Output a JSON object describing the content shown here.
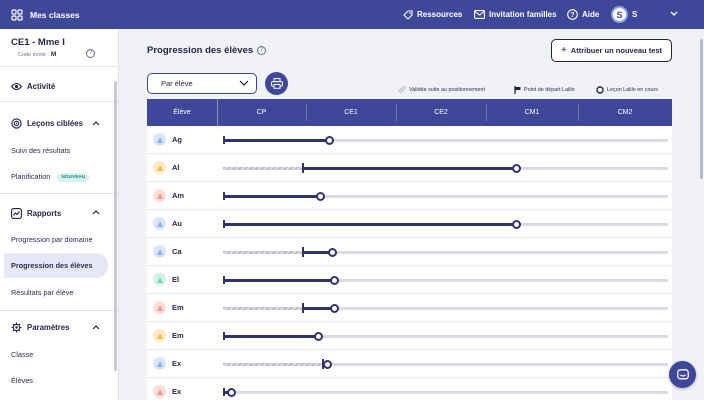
{
  "topbar": {
    "brand": "Mes classes",
    "nav": [
      {
        "label": "Ressources",
        "icon": "tag-icon"
      },
      {
        "label": "Invitation familles",
        "icon": "mail-icon"
      },
      {
        "label": "Aide",
        "icon": "help-circle-icon"
      }
    ],
    "user_initial": "S",
    "user_name": "S"
  },
  "sidebar": {
    "class_name": "CE1 - Mme I",
    "code_label": "Code école :",
    "code_value": "M",
    "sections": [
      {
        "label": "Activité",
        "icon": "eye-icon"
      },
      {
        "label": "Leçons ciblées",
        "icon": "target-icon",
        "items": [
          "Suivi des résultats",
          "Planification"
        ],
        "badge": "NOUVEAU"
      },
      {
        "label": "Rapports",
        "icon": "chart-icon",
        "items": [
          "Progression par domaine",
          "Progression des élèves",
          "Résultats par élève"
        ]
      },
      {
        "label": "Paramètres",
        "icon": "gear-icon",
        "items": [
          "Classe",
          "Élèves"
        ]
      }
    ],
    "active_item": "Progression des élèves"
  },
  "main": {
    "title": "Progression des élèves",
    "add_test_button": "Attribuer un nouveau test",
    "add_test_prefix": "+",
    "select_value": "Par élève",
    "legend": [
      "Validée suite au positionnement",
      "Point de départ Lalilo",
      "Leçon Lalilo en cours"
    ],
    "columns": [
      "Élève",
      "CP",
      "CE1",
      "CE2",
      "CM1",
      "CM2"
    ],
    "students": [
      {
        "name": "Ag",
        "avatar_color": "#8fb2ee",
        "validated": 0.0,
        "current": 0.24
      },
      {
        "name": "Al",
        "avatar_color": "#f5c14a",
        "validated": 0.18,
        "current": 0.66
      },
      {
        "name": "Am",
        "avatar_color": "#f29b8a",
        "validated": 0.0,
        "current": 0.22
      },
      {
        "name": "Au",
        "avatar_color": "#8fb2ee",
        "validated": 0.0,
        "current": 0.66
      },
      {
        "name": "Ca",
        "avatar_color": "#8fb2ee",
        "validated": 0.18,
        "current": 0.245
      },
      {
        "name": "El",
        "avatar_color": "#7fd1b9",
        "validated": 0.0,
        "current": 0.25
      },
      {
        "name": "Em",
        "avatar_color": "#f29b8a",
        "validated": 0.18,
        "current": 0.25
      },
      {
        "name": "Em",
        "avatar_color": "#f5c14a",
        "validated": 0.0,
        "current": 0.215
      },
      {
        "name": "Ex",
        "avatar_color": "#8fb2ee",
        "validated": 0.225,
        "current": 0.235
      },
      {
        "name": "Ex",
        "avatar_color": "#f29b8a",
        "validated": 0.0,
        "current": 0.018
      }
    ]
  },
  "colors": {
    "primary": "#3f4799",
    "bar": "#2e336a",
    "track": "#d8dae4"
  }
}
